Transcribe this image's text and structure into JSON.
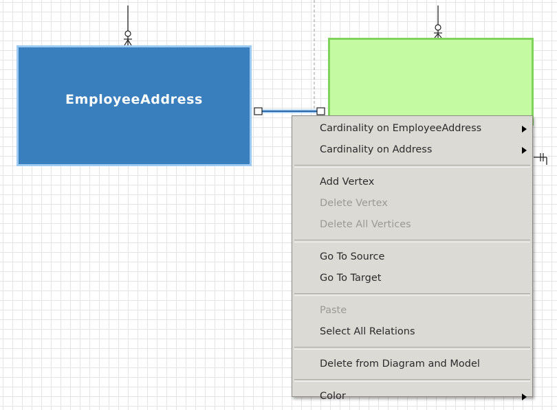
{
  "diagram": {
    "entities": [
      {
        "name": "EmployeeAddress",
        "fill": "#3a7fbd",
        "border": "#9ccaf2"
      },
      {
        "name": "",
        "fill": "#c4fba2",
        "border": "#7fd25a"
      }
    ]
  },
  "context_menu": {
    "cardinality_source": "Cardinality on EmployeeAddress",
    "cardinality_target": "Cardinality on Address",
    "add_vertex": "Add Vertex",
    "delete_vertex": "Delete Vertex",
    "delete_all_vertices": "Delete All Vertices",
    "go_to_source": "Go To Source",
    "go_to_target": "Go To Target",
    "paste": "Paste",
    "select_all_relations": "Select All Relations",
    "delete_from_diagram_and_model": "Delete from Diagram and Model",
    "color": "Color"
  }
}
